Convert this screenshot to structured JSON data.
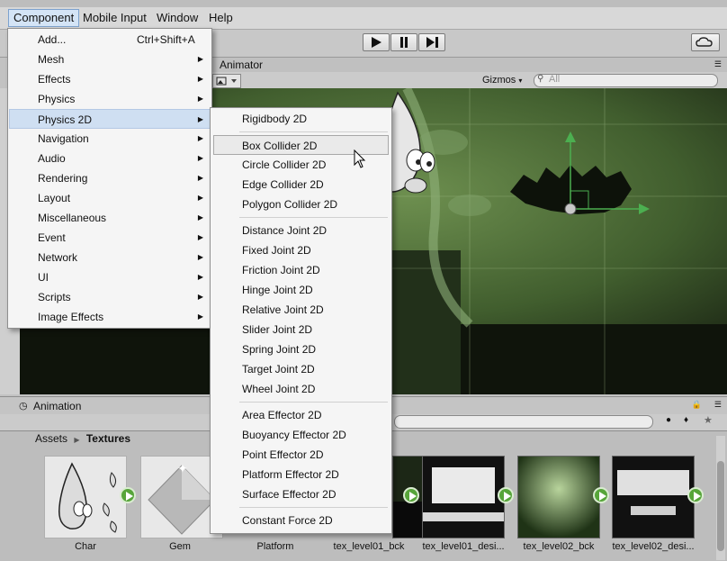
{
  "menubar": {
    "items": [
      {
        "label": "Component",
        "active": true
      },
      {
        "label": "Mobile Input"
      },
      {
        "label": "Window"
      },
      {
        "label": "Help"
      }
    ]
  },
  "toolbar": {
    "play_icon": "play-icon",
    "pause_icon": "pause-icon",
    "step_icon": "step-icon",
    "cloud_icon": "cloud-icon"
  },
  "scene": {
    "tab_label": "Animator",
    "gizmos_label": "Gizmos",
    "search_placeholder": "All"
  },
  "component_menu": {
    "items": [
      {
        "label": "Add...",
        "shortcut": "Ctrl+Shift+A",
        "submenu": false
      },
      {
        "label": "Mesh",
        "submenu": true
      },
      {
        "label": "Effects",
        "submenu": true
      },
      {
        "label": "Physics",
        "submenu": true
      },
      {
        "label": "Physics 2D",
        "submenu": true,
        "highlighted": true
      },
      {
        "label": "Navigation",
        "submenu": true
      },
      {
        "label": "Audio",
        "submenu": true
      },
      {
        "label": "Rendering",
        "submenu": true
      },
      {
        "label": "Layout",
        "submenu": true
      },
      {
        "label": "Miscellaneous",
        "submenu": true
      },
      {
        "label": "Event",
        "submenu": true
      },
      {
        "label": "Network",
        "submenu": true
      },
      {
        "label": "UI",
        "submenu": true
      },
      {
        "label": "Scripts",
        "submenu": true
      },
      {
        "label": "Image Effects",
        "submenu": true
      }
    ]
  },
  "physics2d_menu": {
    "groups": [
      [
        "Rigidbody 2D"
      ],
      [
        "Box Collider 2D",
        "Circle Collider 2D",
        "Edge Collider 2D",
        "Polygon Collider 2D"
      ],
      [
        "Distance Joint 2D",
        "Fixed Joint 2D",
        "Friction Joint 2D",
        "Hinge Joint 2D",
        "Relative Joint 2D",
        "Slider Joint 2D",
        "Spring Joint 2D",
        "Target Joint 2D",
        "Wheel Joint 2D"
      ],
      [
        "Area Effector 2D",
        "Buoyancy Effector 2D",
        "Point Effector 2D",
        "Platform Effector 2D",
        "Surface Effector 2D"
      ],
      [
        "Constant Force 2D"
      ]
    ],
    "items": [
      "Rigidbody 2D",
      "Box Collider 2D",
      "Circle Collider 2D",
      "Edge Collider 2D",
      "Polygon Collider 2D",
      "Distance Joint 2D",
      "Fixed Joint 2D",
      "Friction Joint 2D",
      "Hinge Joint 2D",
      "Relative Joint 2D",
      "Slider Joint 2D",
      "Spring Joint 2D",
      "Target Joint 2D",
      "Wheel Joint 2D",
      "Area Effector 2D",
      "Buoyancy Effector 2D",
      "Point Effector 2D",
      "Platform Effector 2D",
      "Surface Effector 2D",
      "Constant Force 2D"
    ],
    "hovered": "Box Collider 2D"
  },
  "animation_panel": {
    "label": "Animation"
  },
  "project": {
    "breadcrumb": [
      "Assets",
      "Textures"
    ],
    "assets": [
      {
        "label": "Char"
      },
      {
        "label": "Gem"
      },
      {
        "label": "Platform"
      },
      {
        "label": "tex_level01_bck"
      },
      {
        "label": "tex_level01_desi..."
      },
      {
        "label": "tex_level02_bck"
      },
      {
        "label": "tex_level02_desi..."
      }
    ]
  },
  "colors": {
    "highlight": "#cfdff2",
    "scene_green": "#3d5a2a",
    "play_badge": "#57a53a"
  }
}
